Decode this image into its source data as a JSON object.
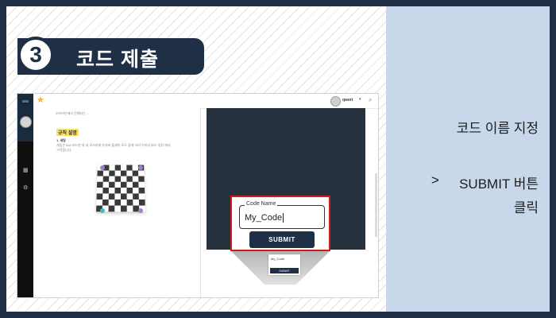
{
  "step": {
    "number": "3",
    "title": "코드 제출"
  },
  "app": {
    "rail_icons": [
      "chart-icon",
      "puzzle-icon"
    ],
    "topbar": {
      "user_name": "qwert",
      "caret": "▾"
    },
    "document": {
      "intro_text": "오프라인에서 전해지는 ...",
      "heading": "규칙 설명",
      "subheading": "1. 세팅",
      "body_text": "게임은 8x8 보드판 위 네 모서리에 유저와 플레이 모두 중재 자리 이미지 보드 설정 에서 시작합니다."
    },
    "code_name": {
      "legend": "Code Name",
      "value": "My_Code"
    },
    "submit_label": "SUBMIT",
    "mini_preview": {
      "legend": "My_Code",
      "button": "SUBMIT"
    }
  },
  "instructions": {
    "line1": "코드 이름 지정",
    "arrow": ">",
    "line2": "SUBMIT 버튼",
    "line3": "클릭"
  },
  "colors": {
    "frame": "#1f2f45",
    "right_panel": "#c9d7ea",
    "highlight_border": "#d21a1a",
    "button": "#1f2f45",
    "editor_bg": "#26323e",
    "star": "#f2b51e"
  }
}
